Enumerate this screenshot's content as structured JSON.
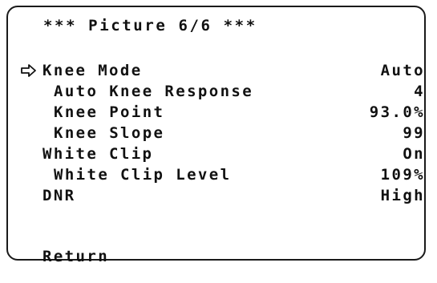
{
  "menu": {
    "title": "*** Picture 6/6 ***",
    "cursor_icon": "right-arrow-outline-icon",
    "items": [
      {
        "label": "Knee Mode",
        "value": "Auto",
        "level": 0,
        "selected": true
      },
      {
        "label": "Auto Knee Response",
        "value": "4",
        "level": 1,
        "selected": false
      },
      {
        "label": "Knee Point",
        "value": "93.0%",
        "level": 1,
        "selected": false
      },
      {
        "label": "Knee Slope",
        "value": "99",
        "level": 1,
        "selected": false
      },
      {
        "label": "White Clip",
        "value": "On",
        "level": 0,
        "selected": false
      },
      {
        "label": "White Clip Level",
        "value": "109%",
        "level": 1,
        "selected": false
      },
      {
        "label": "DNR",
        "value": "High",
        "level": 0,
        "selected": false
      }
    ],
    "return_label": "Return"
  }
}
